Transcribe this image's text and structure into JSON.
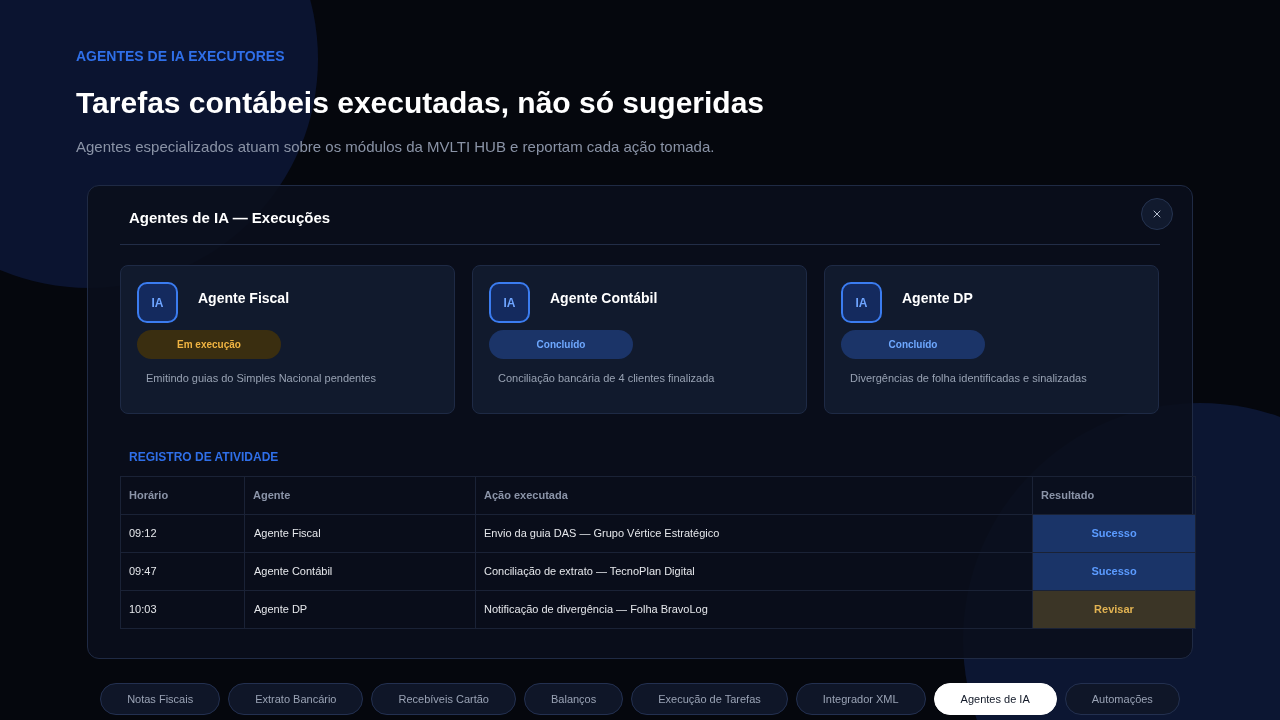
{
  "header": {
    "eyebrow": "AGENTES DE IA EXECUTORES",
    "title": "Tarefas contábeis executadas, não só sugeridas",
    "subtitle": "Agentes especializados atuam sobre os módulos da MVLTI HUB e reportam cada ação tomada."
  },
  "dialog": {
    "title": "Agentes de IA — Execuções",
    "agents": [
      {
        "avatar": "IA",
        "name": "Agente Fiscal",
        "status": {
          "label": "Em execução",
          "kind": "running"
        },
        "description": "Emitindo guias do Simples Nacional pendentes"
      },
      {
        "avatar": "IA",
        "name": "Agente Contábil",
        "status": {
          "label": "Concluído",
          "kind": "done"
        },
        "description": "Conciliação bancária de 4 clientes finalizada"
      },
      {
        "avatar": "IA",
        "name": "Agente DP",
        "status": {
          "label": "Concluído",
          "kind": "done"
        },
        "description": "Divergências de folha identificadas e sinalizadas"
      }
    ],
    "activity_log": {
      "title": "REGISTRO DE ATIVIDADE",
      "columns": [
        "Horário",
        "Agente",
        "Ação executada",
        "Resultado"
      ],
      "rows": [
        {
          "time": "09:12",
          "agent": "Agente Fiscal",
          "action": "Envio da guia DAS — Grupo Vértice Estratégico",
          "result": {
            "label": "Sucesso",
            "kind": "success"
          }
        },
        {
          "time": "09:47",
          "agent": "Agente Contábil",
          "action": "Conciliação de extrato — TecnoPlan Digital",
          "result": {
            "label": "Sucesso",
            "kind": "success"
          }
        },
        {
          "time": "10:03",
          "agent": "Agente DP",
          "action": "Notificação de divergência — Folha BravoLog",
          "result": {
            "label": "Revisar",
            "kind": "review"
          }
        }
      ]
    }
  },
  "tabs": [
    {
      "label": "Notas Fiscais",
      "selected": false
    },
    {
      "label": "Extrato Bancário",
      "selected": false
    },
    {
      "label": "Recebíveis Cartão",
      "selected": false
    },
    {
      "label": "Balanços",
      "selected": false
    },
    {
      "label": "Execução de Tarefas",
      "selected": false
    },
    {
      "label": "Integrador XML",
      "selected": false
    },
    {
      "label": "Agentes de IA",
      "selected": true
    },
    {
      "label": "Automações",
      "selected": false
    }
  ]
}
